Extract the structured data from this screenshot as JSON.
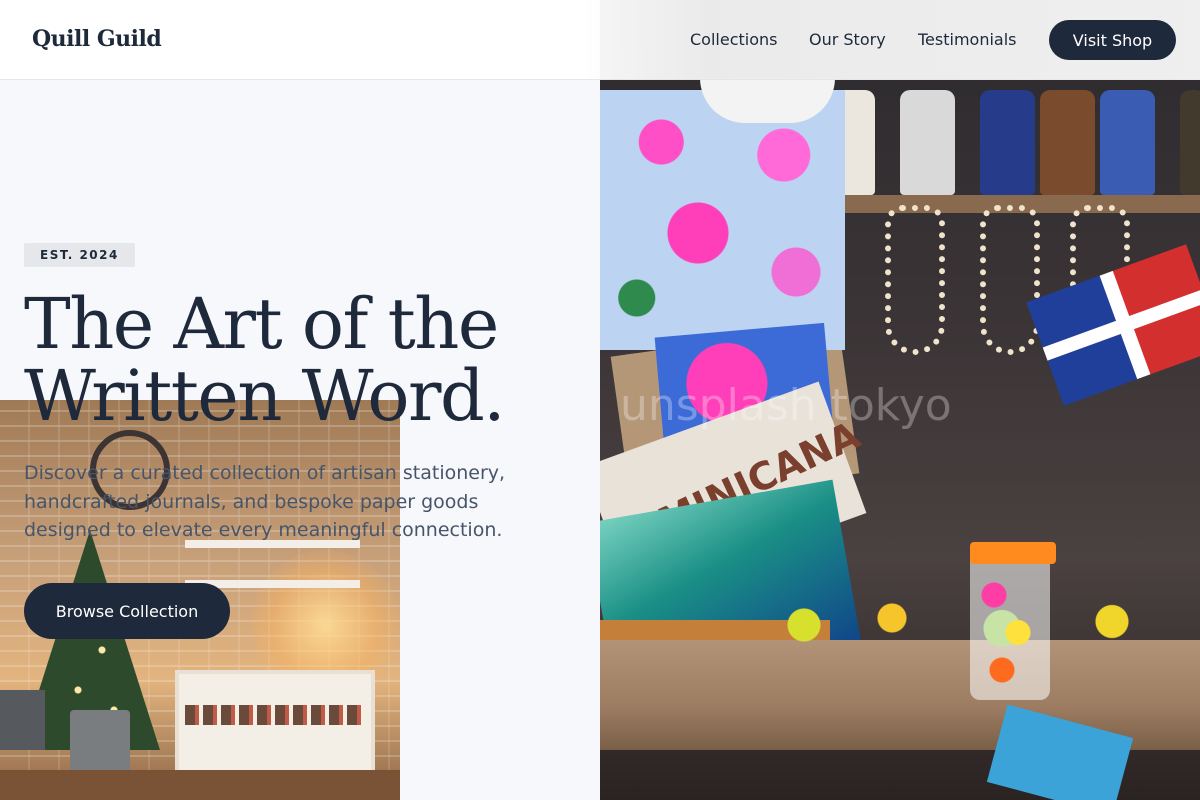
{
  "brand": {
    "name": "Quill Guild"
  },
  "nav": {
    "links": [
      "Collections",
      "Our Story",
      "Testimonials"
    ],
    "cta_label": "Visit Shop"
  },
  "hero": {
    "badge": "EST. 2024",
    "title_line1": "The Art of the",
    "title_line2": "Written Word.",
    "description": "Discover a curated collection of artisan stationery, handcrafted journals, and bespoke paper goods designed to elevate every meaningful connection.",
    "button_label": "Browse Collection"
  },
  "images": {
    "right_photo_text": "DOMINICANA",
    "right_photo_watermark": "unsplash tokyo"
  },
  "colors": {
    "primary": "#1e293b",
    "text_muted": "#475569",
    "page_background": "#f7f8fc",
    "badge_background": "#e5e7eb"
  }
}
